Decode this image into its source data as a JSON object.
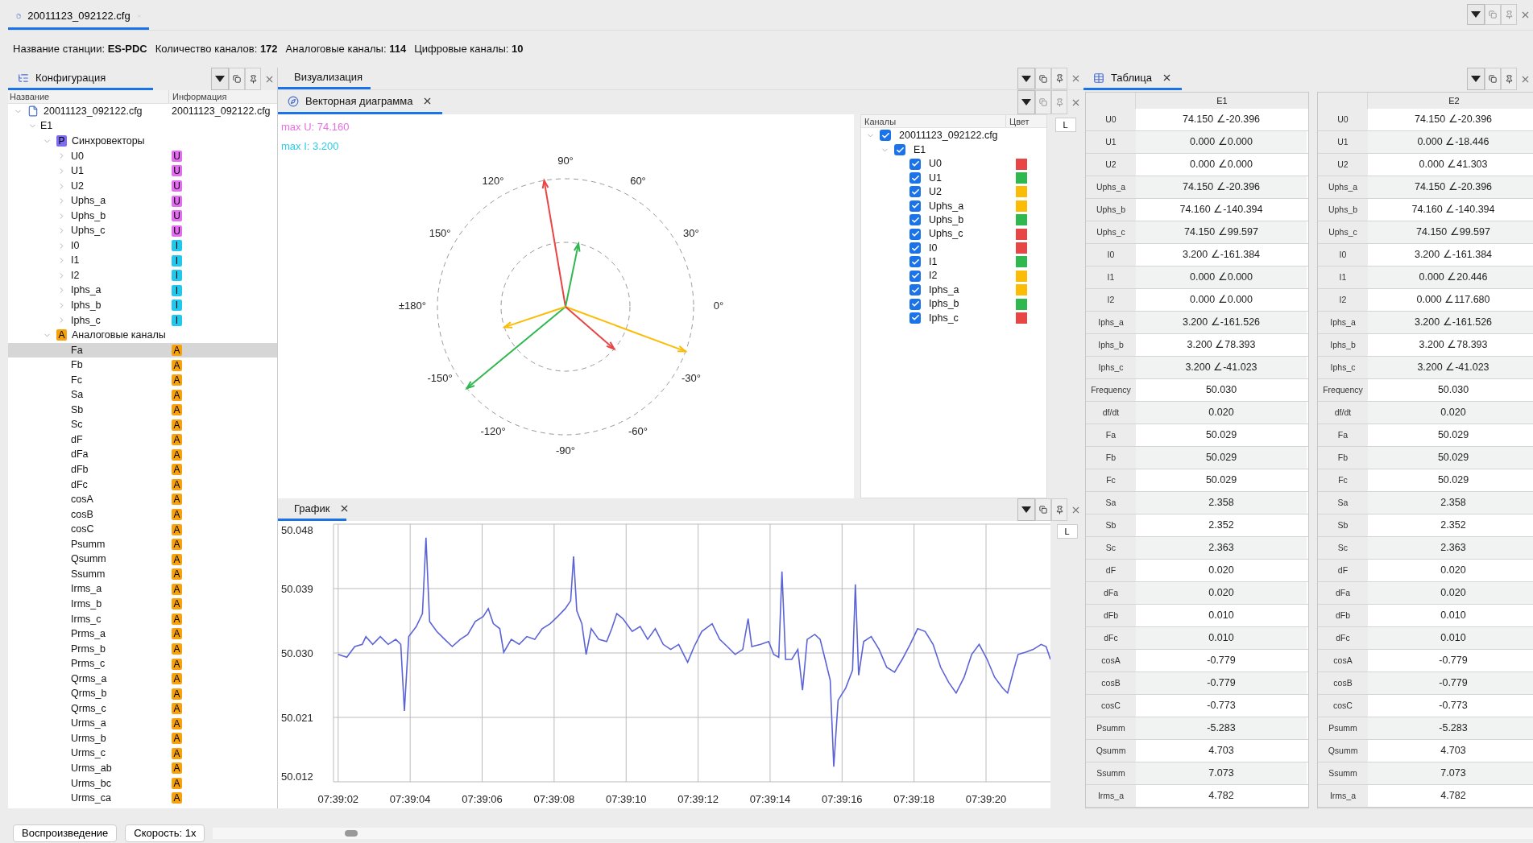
{
  "document_tab": {
    "label": "20011123_092122.cfg",
    "selected": true
  },
  "station_info": [
    "Название станции: **ES-PDC**",
    "Количество каналов: **172**",
    "Аналоговые каналы: **114**",
    "Цифровые каналы: **10**"
  ],
  "config_panel": {
    "tab": {
      "label": "Конфигурация",
      "selected": true
    },
    "columns": [
      "Название",
      "Информация"
    ],
    "tree": [
      {
        "label": "20011123_092122.cfg",
        "info": "20011123_092122.cfg",
        "kind": "file",
        "expanded": true,
        "selected": false,
        "children": [
          {
            "label": "E1",
            "expanded": true,
            "selected": false,
            "children": [
              {
                "label": "Синхровекторы",
                "badge": "P",
                "kind": "phasor",
                "expanded": true,
                "selected": false,
                "children": [
                  {
                    "label": "U0",
                    "badge": "U",
                    "kind": "voltage",
                    "expanded": false,
                    "selected": false
                  },
                  {
                    "label": "U1",
                    "badge": "U",
                    "kind": "voltage",
                    "expanded": false,
                    "selected": false
                  },
                  {
                    "label": "U2",
                    "badge": "U",
                    "kind": "voltage",
                    "expanded": false,
                    "selected": false
                  },
                  {
                    "label": "Uphs_a",
                    "badge": "U",
                    "kind": "voltage",
                    "expanded": false,
                    "selected": false
                  },
                  {
                    "label": "Uphs_b",
                    "badge": "U",
                    "kind": "voltage",
                    "expanded": false,
                    "selected": false
                  },
                  {
                    "label": "Uphs_c",
                    "badge": "U",
                    "kind": "voltage",
                    "expanded": false,
                    "selected": false
                  },
                  {
                    "label": "I0",
                    "badge": "I",
                    "kind": "current",
                    "expanded": false,
                    "selected": false
                  },
                  {
                    "label": "I1",
                    "badge": "I",
                    "kind": "current",
                    "expanded": false,
                    "selected": false
                  },
                  {
                    "label": "I2",
                    "badge": "I",
                    "kind": "current",
                    "expanded": false,
                    "selected": false
                  },
                  {
                    "label": "Iphs_a",
                    "badge": "I",
                    "kind": "current",
                    "expanded": false,
                    "selected": false
                  },
                  {
                    "label": "Iphs_b",
                    "badge": "I",
                    "kind": "current",
                    "expanded": false,
                    "selected": false
                  },
                  {
                    "label": "Iphs_c",
                    "badge": "I",
                    "kind": "current",
                    "expanded": false,
                    "selected": false
                  }
                ]
              },
              {
                "label": "Аналоговые каналы",
                "badge": "A",
                "kind": "analog",
                "expanded": true,
                "selected": false,
                "children": [
                  {
                    "label": "Fa",
                    "badge": "A",
                    "kind": "analog",
                    "selected": true
                  },
                  {
                    "label": "Fb",
                    "badge": "A",
                    "kind": "analog",
                    "selected": false
                  },
                  {
                    "label": "Fc",
                    "badge": "A",
                    "kind": "analog",
                    "selected": false
                  },
                  {
                    "label": "Sa",
                    "badge": "A",
                    "kind": "analog",
                    "selected": false
                  },
                  {
                    "label": "Sb",
                    "badge": "A",
                    "kind": "analog",
                    "selected": false
                  },
                  {
                    "label": "Sc",
                    "badge": "A",
                    "kind": "analog",
                    "selected": false
                  },
                  {
                    "label": "dF",
                    "badge": "A",
                    "kind": "analog",
                    "selected": false
                  },
                  {
                    "label": "dFa",
                    "badge": "A",
                    "kind": "analog",
                    "selected": false
                  },
                  {
                    "label": "dFb",
                    "badge": "A",
                    "kind": "analog",
                    "selected": false
                  },
                  {
                    "label": "dFc",
                    "badge": "A",
                    "kind": "analog",
                    "selected": false
                  },
                  {
                    "label": "cosA",
                    "badge": "A",
                    "kind": "analog",
                    "selected": false
                  },
                  {
                    "label": "cosB",
                    "badge": "A",
                    "kind": "analog",
                    "selected": false
                  },
                  {
                    "label": "cosC",
                    "badge": "A",
                    "kind": "analog",
                    "selected": false
                  },
                  {
                    "label": "Psumm",
                    "badge": "A",
                    "kind": "analog",
                    "selected": false
                  },
                  {
                    "label": "Qsumm",
                    "badge": "A",
                    "kind": "analog",
                    "selected": false
                  },
                  {
                    "label": "Ssumm",
                    "badge": "A",
                    "kind": "analog",
                    "selected": false
                  },
                  {
                    "label": "Irms_a",
                    "badge": "A",
                    "kind": "analog",
                    "selected": false
                  },
                  {
                    "label": "Irms_b",
                    "badge": "A",
                    "kind": "analog",
                    "selected": false
                  },
                  {
                    "label": "Irms_c",
                    "badge": "A",
                    "kind": "analog",
                    "selected": false
                  },
                  {
                    "label": "Prms_a",
                    "badge": "A",
                    "kind": "analog",
                    "selected": false
                  },
                  {
                    "label": "Prms_b",
                    "badge": "A",
                    "kind": "analog",
                    "selected": false
                  },
                  {
                    "label": "Prms_c",
                    "badge": "A",
                    "kind": "analog",
                    "selected": false
                  },
                  {
                    "label": "Qrms_a",
                    "badge": "A",
                    "kind": "analog",
                    "selected": false
                  },
                  {
                    "label": "Qrms_b",
                    "badge": "A",
                    "kind": "analog",
                    "selected": false
                  },
                  {
                    "label": "Qrms_c",
                    "badge": "A",
                    "kind": "analog",
                    "selected": false
                  },
                  {
                    "label": "Urms_a",
                    "badge": "A",
                    "kind": "analog",
                    "selected": false
                  },
                  {
                    "label": "Urms_b",
                    "badge": "A",
                    "kind": "analog",
                    "selected": false
                  },
                  {
                    "label": "Urms_c",
                    "badge": "A",
                    "kind": "analog",
                    "selected": false
                  },
                  {
                    "label": "Urms_ab",
                    "badge": "A",
                    "kind": "analog",
                    "selected": false
                  },
                  {
                    "label": "Urms_bc",
                    "badge": "A",
                    "kind": "analog",
                    "selected": false
                  },
                  {
                    "label": "Urms_ca",
                    "badge": "A",
                    "kind": "analog",
                    "selected": false
                  }
                ]
              }
            ]
          }
        ]
      }
    ]
  },
  "visualization_panel": {
    "tab": {
      "label": "Визуализация",
      "selected": true
    },
    "vector_tab": {
      "label": "Векторная диаграмма",
      "selected": true
    },
    "max_labels": [
      {
        "text": "max U: 74.160",
        "color": "#e86ee6"
      },
      {
        "text": "max I: 3.200",
        "color": "#2ccbe6"
      }
    ],
    "angle_labels": [
      "0°",
      "30°",
      "60°",
      "90°",
      "120°",
      "150°",
      "±180°",
      "-150°",
      "-120°",
      "-90°",
      "-60°",
      "-30°"
    ],
    "side_button": "L",
    "channels": {
      "columns": [
        "Каналы",
        "Цвет"
      ],
      "root": {
        "label": "20011123_092122.cfg",
        "checked": true,
        "expanded": true,
        "children": [
          {
            "label": "E1",
            "checked": true,
            "expanded": true,
            "children": [
              {
                "label": "U0",
                "checked": true,
                "color": "#e84545"
              },
              {
                "label": "U1",
                "checked": true,
                "color": "#2fb84e"
              },
              {
                "label": "U2",
                "checked": true,
                "color": "#fbbc05"
              },
              {
                "label": "Uphs_a",
                "checked": true,
                "color": "#fbbc05"
              },
              {
                "label": "Uphs_b",
                "checked": true,
                "color": "#2fb84e"
              },
              {
                "label": "Uphs_c",
                "checked": true,
                "color": "#e84545"
              },
              {
                "label": "I0",
                "checked": true,
                "color": "#e84545"
              },
              {
                "label": "I1",
                "checked": true,
                "color": "#2fb84e"
              },
              {
                "label": "I2",
                "checked": true,
                "color": "#fbbc05"
              },
              {
                "label": "Iphs_a",
                "checked": true,
                "color": "#fbbc05"
              },
              {
                "label": "Iphs_b",
                "checked": true,
                "color": "#2fb84e"
              },
              {
                "label": "Iphs_c",
                "checked": true,
                "color": "#e84545"
              }
            ]
          }
        ]
      }
    }
  },
  "graph_panel": {
    "tab": {
      "label": "График",
      "selected": true
    },
    "side_button": "L",
    "chart_data": {
      "type": "line",
      "grid": true,
      "xlim": [
        27541.87,
        27561.79
      ],
      "ylim": [
        50.012,
        50.048
      ],
      "xticks": [
        {
          "value": 27542,
          "label": "07:39:02"
        },
        {
          "value": 27544,
          "label": "07:39:04"
        },
        {
          "value": 27546,
          "label": "07:39:06"
        },
        {
          "value": 27548,
          "label": "07:39:08"
        },
        {
          "value": 27550,
          "label": "07:39:10"
        },
        {
          "value": 27552,
          "label": "07:39:12"
        },
        {
          "value": 27554,
          "label": "07:39:14"
        },
        {
          "value": 27556,
          "label": "07:39:16"
        },
        {
          "value": 27558,
          "label": "07:39:18"
        },
        {
          "value": 27560,
          "label": "07:39:20"
        }
      ],
      "yticks": [
        {
          "value": 50.012,
          "label": "50.012"
        },
        {
          "value": 50.021,
          "label": "50.021"
        },
        {
          "value": 50.03,
          "label": "50.030"
        },
        {
          "value": 50.039,
          "label": "50.039"
        },
        {
          "value": 50.048,
          "label": "50.048"
        }
      ],
      "x": [
        27542,
        27542.24,
        27542.46,
        27542.67,
        27542.77,
        27542.96,
        27543.17,
        27543.39,
        27543.6,
        27543.74,
        27543.84,
        27543.96,
        27544.17,
        27544.34,
        27544.44,
        27544.54,
        27544.74,
        27544.96,
        27545.17,
        27545.39,
        27545.6,
        27545.81,
        27546.03,
        27546.17,
        27546.31,
        27546.49,
        27546.6,
        27546.81,
        27547.03,
        27547.24,
        27547.46,
        27547.67,
        27547.89,
        27548.1,
        27548.31,
        27548.46,
        27548.54,
        27548.63,
        27548.77,
        27548.89,
        27549.03,
        27549.24,
        27549.46,
        27549.6,
        27549.74,
        27549.91,
        27550.17,
        27550.39,
        27550.6,
        27550.81,
        27551.03,
        27551.24,
        27551.46,
        27551.6,
        27551.71,
        27551.89,
        27552.1,
        27552.39,
        27552.6,
        27552.81,
        27553.03,
        27553.24,
        27553.39,
        27553.49,
        27553.74,
        27553.96,
        27554.1,
        27554.24,
        27554.33,
        27554.43,
        27554.6,
        27554.77,
        27554.9,
        27555.03,
        27555.24,
        27555.39,
        27555.53,
        27555.67,
        27555.77,
        27555.89,
        27556.1,
        27556.29,
        27556.37,
        27556.46,
        27556.6,
        27556.81,
        27557.03,
        27557.24,
        27557.46,
        27557.67,
        27557.89,
        27558.1,
        27558.31,
        27558.53,
        27558.74,
        27558.96,
        27559.17,
        27559.39,
        27559.6,
        27559.81,
        27560.03,
        27560.24,
        27560.46,
        27560.6,
        27560.77,
        27560.89,
        27561.1,
        27561.31,
        27561.53,
        27561.67,
        27561.79
      ],
      "series": [
        {
          "color": "#5b63d6",
          "values": [
            50.0298,
            50.0294,
            50.0309,
            50.0312,
            50.0323,
            50.0312,
            50.0323,
            50.0312,
            50.0319,
            50.0312,
            50.0219,
            50.0323,
            50.0337,
            50.0355,
            50.0461,
            50.0344,
            50.033,
            50.0319,
            50.0309,
            50.0319,
            50.0326,
            50.0344,
            50.0351,
            50.0362,
            50.0341,
            50.0334,
            50.0301,
            50.0319,
            50.0312,
            50.0323,
            50.0319,
            50.0334,
            50.0341,
            50.0351,
            50.0362,
            50.0373,
            50.0435,
            50.0359,
            50.0341,
            50.0298,
            50.0334,
            50.0319,
            50.0316,
            50.0334,
            50.0355,
            50.0348,
            50.033,
            50.0337,
            50.0319,
            50.0334,
            50.0312,
            50.0305,
            50.0312,
            50.0298,
            50.0287,
            50.0309,
            50.033,
            50.0341,
            50.0319,
            50.0309,
            50.0298,
            50.0305,
            50.0348,
            50.0309,
            50.0312,
            50.0316,
            50.0298,
            50.0294,
            50.0414,
            50.0291,
            50.0291,
            50.0305,
            50.0248,
            50.0319,
            50.0326,
            50.0319,
            50.0291,
            50.0262,
            50.0141,
            50.0234,
            50.0251,
            50.0276,
            50.0396,
            50.0269,
            50.0316,
            50.0323,
            50.0305,
            50.028,
            50.0273,
            50.0291,
            50.0312,
            50.0334,
            50.033,
            50.0312,
            50.028,
            50.0259,
            50.0244,
            50.0266,
            50.0298,
            50.0312,
            50.0291,
            50.0266,
            50.0251,
            50.0244,
            50.0276,
            50.0298,
            50.0301,
            50.0305,
            50.0312,
            50.0309,
            50.0291
          ]
        }
      ]
    }
  },
  "table_panel": {
    "tab": {
      "label": "Таблица",
      "selected": true
    },
    "tables": [
      {
        "column": "E1",
        "rows": [
          {
            "label": "U0",
            "value": "74.150 ∠-20.396"
          },
          {
            "label": "U1",
            "value": "0.000 ∠0.000"
          },
          {
            "label": "U2",
            "value": "0.000 ∠0.000"
          },
          {
            "label": "Uphs_a",
            "value": "74.150 ∠-20.396"
          },
          {
            "label": "Uphs_b",
            "value": "74.160 ∠-140.394"
          },
          {
            "label": "Uphs_c",
            "value": "74.150 ∠99.597"
          },
          {
            "label": "I0",
            "value": "3.200 ∠-161.384"
          },
          {
            "label": "I1",
            "value": "0.000 ∠0.000"
          },
          {
            "label": "I2",
            "value": "0.000 ∠0.000"
          },
          {
            "label": "Iphs_a",
            "value": "3.200 ∠-161.526"
          },
          {
            "label": "Iphs_b",
            "value": "3.200 ∠78.393"
          },
          {
            "label": "Iphs_c",
            "value": "3.200 ∠-41.023"
          },
          {
            "label": "Frequency",
            "value": "50.030"
          },
          {
            "label": "df/dt",
            "value": "0.020"
          },
          {
            "label": "Fa",
            "value": "50.029"
          },
          {
            "label": "Fb",
            "value": "50.029"
          },
          {
            "label": "Fc",
            "value": "50.029"
          },
          {
            "label": "Sa",
            "value": "2.358"
          },
          {
            "label": "Sb",
            "value": "2.352"
          },
          {
            "label": "Sc",
            "value": "2.363"
          },
          {
            "label": "dF",
            "value": "0.020"
          },
          {
            "label": "dFa",
            "value": "0.020"
          },
          {
            "label": "dFb",
            "value": "0.010"
          },
          {
            "label": "dFc",
            "value": "0.010"
          },
          {
            "label": "cosA",
            "value": "-0.779"
          },
          {
            "label": "cosB",
            "value": "-0.779"
          },
          {
            "label": "cosC",
            "value": "-0.773"
          },
          {
            "label": "Psumm",
            "value": "-5.283"
          },
          {
            "label": "Qsumm",
            "value": "4.703"
          },
          {
            "label": "Ssumm",
            "value": "7.073"
          },
          {
            "label": "Irms_a",
            "value": "4.782"
          }
        ]
      },
      {
        "column": "E2",
        "rows": [
          {
            "label": "U0",
            "value": "74.150 ∠-20.396"
          },
          {
            "label": "U1",
            "value": "0.000 ∠-18.446"
          },
          {
            "label": "U2",
            "value": "0.000 ∠41.303"
          },
          {
            "label": "Uphs_a",
            "value": "74.150 ∠-20.396"
          },
          {
            "label": "Uphs_b",
            "value": "74.160 ∠-140.394"
          },
          {
            "label": "Uphs_c",
            "value": "74.150 ∠99.597"
          },
          {
            "label": "I0",
            "value": "3.200 ∠-161.384"
          },
          {
            "label": "I1",
            "value": "0.000 ∠20.446"
          },
          {
            "label": "I2",
            "value": "0.000 ∠117.680"
          },
          {
            "label": "Iphs_a",
            "value": "3.200 ∠-161.526"
          },
          {
            "label": "Iphs_b",
            "value": "3.200 ∠78.393"
          },
          {
            "label": "Iphs_c",
            "value": "3.200 ∠-41.023"
          },
          {
            "label": "Frequency",
            "value": "50.030"
          },
          {
            "label": "df/dt",
            "value": "0.020"
          },
          {
            "label": "Fa",
            "value": "50.029"
          },
          {
            "label": "Fb",
            "value": "50.029"
          },
          {
            "label": "Fc",
            "value": "50.029"
          },
          {
            "label": "Sa",
            "value": "2.358"
          },
          {
            "label": "Sb",
            "value": "2.352"
          },
          {
            "label": "Sc",
            "value": "2.363"
          },
          {
            "label": "dF",
            "value": "0.020"
          },
          {
            "label": "dFa",
            "value": "0.020"
          },
          {
            "label": "dFb",
            "value": "0.010"
          },
          {
            "label": "dFc",
            "value": "0.010"
          },
          {
            "label": "cosA",
            "value": "-0.779"
          },
          {
            "label": "cosB",
            "value": "-0.779"
          },
          {
            "label": "cosC",
            "value": "-0.773"
          },
          {
            "label": "Psumm",
            "value": "-5.283"
          },
          {
            "label": "Qsumm",
            "value": "4.703"
          },
          {
            "label": "Ssumm",
            "value": "7.073"
          },
          {
            "label": "Irms_a",
            "value": "4.782"
          }
        ]
      }
    ]
  },
  "playback": {
    "play_button": "Воспроизведение",
    "speed_button": "Скорость: 1x",
    "level": 0.1
  }
}
